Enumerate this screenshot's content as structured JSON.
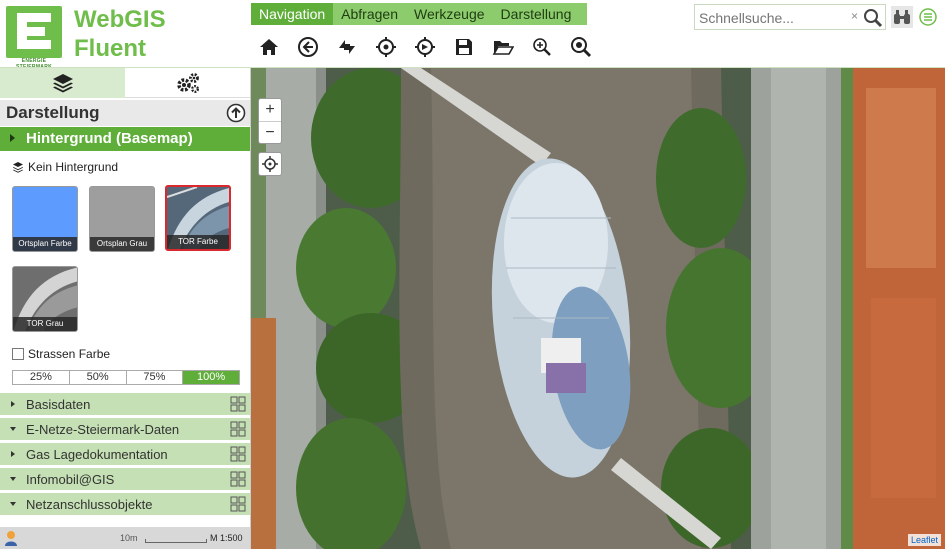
{
  "header": {
    "app_title": "WebGIS\nFluent",
    "logo_subtitle": "ENERGIE STEIERMARK",
    "menu": [
      {
        "label": "Navigation",
        "active": true
      },
      {
        "label": "Abfragen",
        "active": false
      },
      {
        "label": "Werkzeuge",
        "active": false
      },
      {
        "label": "Darstellung",
        "active": false
      }
    ],
    "toolbar": [
      "home-icon",
      "back-icon",
      "full-extent-icon",
      "locate-icon",
      "gps-icon",
      "save-icon",
      "open-folder-icon",
      "zoom-in-icon",
      "zoom-search-icon"
    ]
  },
  "search": {
    "placeholder": "Schnellsuche...",
    "clear": "×"
  },
  "sidebar": {
    "section_title": "Darstellung",
    "basemap_header": "Hintergrund (Basemap)",
    "no_background": "Kein Hintergrund",
    "basemaps": [
      {
        "label": "Ortsplan Farbe",
        "selected": false,
        "color": "#5d9bff"
      },
      {
        "label": "Ortsplan Grau",
        "selected": false,
        "color": "#9e9e9e"
      },
      {
        "label": "TOR Farbe",
        "selected": true,
        "color": "#4a6a88"
      },
      {
        "label": "TOR Grau",
        "selected": false,
        "color": "#7a7a7a"
      }
    ],
    "street_color": "Strassen Farbe",
    "opacity": [
      "25%",
      "50%",
      "75%",
      "100%"
    ],
    "opacity_active": "100%",
    "layer_groups": [
      {
        "label": "Basisdaten",
        "expanded": false
      },
      {
        "label": "E-Netze-Steiermark-Daten",
        "expanded": true
      },
      {
        "label": "Gas Lagedokumentation",
        "expanded": false
      },
      {
        "label": "Infomobil@GIS",
        "expanded": true
      },
      {
        "label": "Netzanschlussobjekte",
        "expanded": true
      }
    ]
  },
  "statusbar": {
    "scale_label": "10m",
    "scale_ratio": "M 1:500"
  },
  "map": {
    "zoom_in": "+",
    "zoom_out": "−",
    "attribution": "Leaflet"
  },
  "colors": {
    "brand_green": "#6fbd4a",
    "active_green": "#5fae3a",
    "layer_green": "#c5e0b4",
    "selected_red": "#d9292e"
  }
}
